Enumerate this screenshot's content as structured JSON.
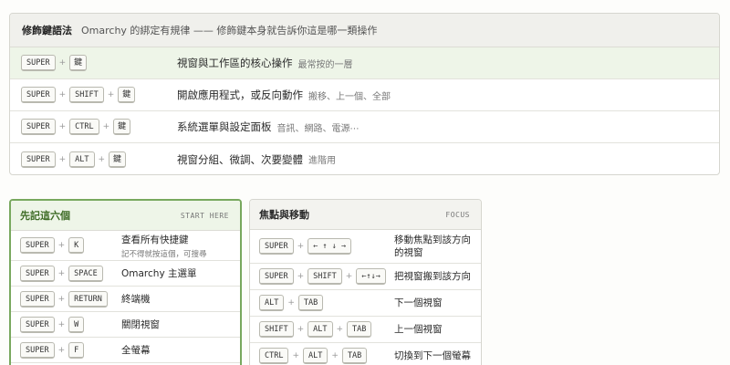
{
  "top": {
    "title": "修飾鍵語法",
    "subtitle": "Omarchy 的綁定有規律 —— 修飾鍵本身就告訴你這是哪一類操作",
    "rows": [
      {
        "keys": [
          "SUPER",
          "鍵"
        ],
        "desc": "視窗與工作區的核心操作",
        "note": "最常按的一層"
      },
      {
        "keys": [
          "SUPER",
          "SHIFT",
          "鍵"
        ],
        "desc": "開啟應用程式，或反向動作",
        "note": "搬移、上一個、全部"
      },
      {
        "keys": [
          "SUPER",
          "CTRL",
          "鍵"
        ],
        "desc": "系統選單與設定面板",
        "note": "音訊、網路、電源⋯"
      },
      {
        "keys": [
          "SUPER",
          "ALT",
          "鍵"
        ],
        "desc": "視窗分組、微調、次要變體",
        "note": "進階用"
      }
    ]
  },
  "left": {
    "title": "先記這六個",
    "tag": "START HERE",
    "rows": [
      {
        "keys": [
          "SUPER",
          "K"
        ],
        "desc": "查看所有快捷鍵",
        "sub": "記不得就按這個，可搜尋"
      },
      {
        "keys": [
          "SUPER",
          "SPACE"
        ],
        "desc": "Omarchy 主選單"
      },
      {
        "keys": [
          "SUPER",
          "RETURN"
        ],
        "desc": "終端機"
      },
      {
        "keys": [
          "SUPER",
          "W"
        ],
        "desc": "關閉視窗"
      },
      {
        "keys": [
          "SUPER",
          "F"
        ],
        "desc": "全螢幕"
      }
    ]
  },
  "right": {
    "title": "焦點與移動",
    "tag": "FOCUS",
    "rows": [
      {
        "keys": [
          "SUPER",
          "← ↑ ↓ →"
        ],
        "desc1": "移動焦點到該方向",
        "desc2": "的視窗"
      },
      {
        "keys": [
          "SUPER",
          "SHIFT",
          "←↑↓→"
        ],
        "desc1": "把視窗搬到該方向"
      },
      {
        "keys": [
          "ALT",
          "TAB"
        ],
        "desc1": "下一個視窗"
      },
      {
        "keys": [
          "SHIFT",
          "ALT",
          "TAB"
        ],
        "desc1": "上一個視窗"
      },
      {
        "keys": [
          "CTRL",
          "ALT",
          "TAB"
        ],
        "desc1": "切換到下一個螢幕"
      }
    ]
  },
  "plus_sign": "+"
}
